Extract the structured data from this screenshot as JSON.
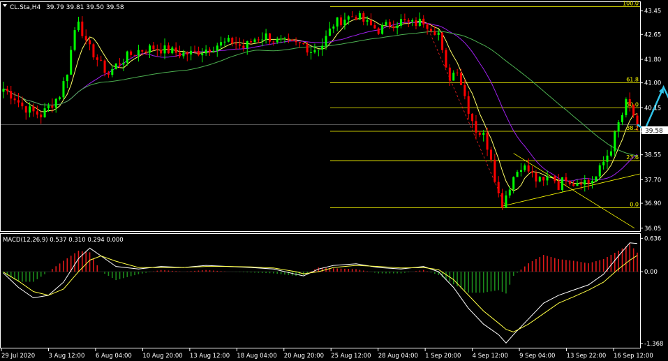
{
  "header": {
    "symbol": "CL.Sta,H4",
    "ohlc": "39.79 39.81 39.50 39.58",
    "macd_label": "MACD(12,26,9) 0.537 0.310 0.294 0.000"
  },
  "colors": {
    "background": "#000000",
    "bull": "#00ff00",
    "bear": "#ff0000",
    "fib": "#ffff00",
    "projection": "#2fc3e8",
    "ma_fast": "#ffff66",
    "ma_mid": "#a020f0",
    "ma_slow": "#4caf50",
    "macd_hist_pos": "#e01a1a",
    "macd_hist_neg": "#1c8a1c",
    "macd_line": "#ffffff",
    "signal_line": "#ffff44",
    "axis": "#ffffff",
    "grid": "#555555"
  },
  "chart_data": {
    "type": "candlestick",
    "price_axis": {
      "ticks": [
        "43.45",
        "42.65",
        "41.80",
        "41.00",
        "40.15",
        "39.35",
        "38.55",
        "37.70",
        "36.90",
        "36.05"
      ],
      "ylim": [
        35.95,
        43.75
      ],
      "current_price": "39.58"
    },
    "macd_axis": {
      "ticks": [
        "0.636",
        "0.00",
        "-1.368"
      ],
      "ylim": [
        -1.45,
        0.72
      ]
    },
    "x_labels": [
      "29 Jul 2020",
      "3 Aug 12:00",
      "6 Aug 04:00",
      "10 Aug 20:00",
      "13 Aug 12:00",
      "18 Aug 04:00",
      "20 Aug 20:00",
      "25 Aug 12:00",
      "28 Aug 04:00",
      "1 Sep 20:00",
      "4 Sep 12:00",
      "9 Sep 04:00",
      "13 Sep 22:00",
      "16 Sep 12:00"
    ],
    "fibonacci": {
      "levels": [
        {
          "label": "100.0",
          "price": 43.6
        },
        {
          "label": "61.8",
          "price": 41.0
        },
        {
          "label": "50.0",
          "price": 40.15
        },
        {
          "label": "38.2",
          "price": 39.35
        },
        {
          "label": "23.6",
          "price": 38.35
        },
        {
          "label": "0.0",
          "price": 36.75
        }
      ]
    },
    "path": [
      [
        0,
        40.8
      ],
      [
        3,
        40.5
      ],
      [
        5,
        40.2
      ],
      [
        8,
        40.0
      ],
      [
        10,
        39.9
      ],
      [
        13,
        40.3
      ],
      [
        15,
        40.6
      ],
      [
        17,
        41.4
      ],
      [
        19,
        42.8
      ],
      [
        20,
        43.2
      ],
      [
        22,
        42.3
      ],
      [
        24,
        42.0
      ],
      [
        26,
        41.6
      ],
      [
        28,
        41.3
      ],
      [
        30,
        41.6
      ],
      [
        33,
        41.9
      ],
      [
        36,
        42.1
      ],
      [
        40,
        42.2
      ],
      [
        44,
        42.1
      ],
      [
        47,
        42.0
      ],
      [
        50,
        42.0
      ],
      [
        53,
        42.1
      ],
      [
        57,
        42.3
      ],
      [
        61,
        42.4
      ],
      [
        64,
        42.2
      ],
      [
        67,
        42.5
      ],
      [
        70,
        42.6
      ],
      [
        73,
        42.4
      ],
      [
        77,
        42.3
      ],
      [
        80,
        42.3
      ],
      [
        82,
        42.1
      ],
      [
        85,
        42.3
      ],
      [
        88,
        43.0
      ],
      [
        91,
        43.2
      ],
      [
        94,
        43.3
      ],
      [
        97,
        43.0
      ],
      [
        100,
        42.8
      ],
      [
        103,
        43.0
      ],
      [
        106,
        43.1
      ],
      [
        109,
        43.0
      ],
      [
        112,
        43.1
      ],
      [
        114,
        42.9
      ],
      [
        116,
        42.7
      ],
      [
        117,
        42.0
      ],
      [
        118,
        41.4
      ],
      [
        119,
        41.2
      ],
      [
        121,
        41.5
      ],
      [
        122,
        41.0
      ],
      [
        124,
        40.1
      ],
      [
        126,
        39.4
      ],
      [
        128,
        39.2
      ],
      [
        130,
        38.5
      ],
      [
        131,
        37.8
      ],
      [
        132,
        37.2
      ],
      [
        133,
        36.9
      ],
      [
        134,
        37.2
      ],
      [
        136,
        37.8
      ],
      [
        138,
        38.2
      ],
      [
        140,
        38.0
      ],
      [
        142,
        37.7
      ],
      [
        144,
        37.6
      ],
      [
        146,
        37.9
      ],
      [
        148,
        37.5
      ],
      [
        150,
        37.8
      ],
      [
        152,
        37.6
      ],
      [
        154,
        37.7
      ],
      [
        156,
        37.6
      ],
      [
        158,
        37.8
      ],
      [
        160,
        38.3
      ],
      [
        162,
        38.8
      ],
      [
        163,
        39.2
      ],
      [
        164,
        39.6
      ],
      [
        165,
        39.9
      ],
      [
        166,
        40.3
      ],
      [
        167,
        40.2
      ],
      [
        168,
        39.9
      ],
      [
        169,
        39.58
      ]
    ],
    "projection": [
      [
        169,
        39.58
      ],
      [
        171,
        39.4
      ],
      [
        176,
        40.85
      ],
      [
        185,
        38.45
      ]
    ],
    "macd": [
      [
        0,
        -0.03
      ],
      [
        4,
        -0.3
      ],
      [
        8,
        -0.5
      ],
      [
        12,
        -0.45
      ],
      [
        16,
        -0.2
      ],
      [
        20,
        0.25
      ],
      [
        23,
        0.45
      ],
      [
        26,
        0.3
      ],
      [
        30,
        0.1
      ],
      [
        36,
        0.05
      ],
      [
        42,
        0.1
      ],
      [
        48,
        0.08
      ],
      [
        54,
        0.12
      ],
      [
        60,
        0.1
      ],
      [
        66,
        0.08
      ],
      [
        72,
        0.05
      ],
      [
        78,
        -0.05
      ],
      [
        80,
        -0.08
      ],
      [
        84,
        0.05
      ],
      [
        88,
        0.12
      ],
      [
        94,
        0.15
      ],
      [
        100,
        0.08
      ],
      [
        106,
        0.05
      ],
      [
        112,
        0.1
      ],
      [
        116,
        0.0
      ],
      [
        120,
        -0.3
      ],
      [
        124,
        -0.7
      ],
      [
        128,
        -1.0
      ],
      [
        132,
        -1.2
      ],
      [
        134,
        -1.36
      ],
      [
        136,
        -1.2
      ],
      [
        140,
        -0.9
      ],
      [
        144,
        -0.6
      ],
      [
        148,
        -0.45
      ],
      [
        152,
        -0.35
      ],
      [
        156,
        -0.25
      ],
      [
        160,
        -0.05
      ],
      [
        164,
        0.3
      ],
      [
        167,
        0.55
      ],
      [
        169,
        0.537
      ]
    ],
    "signal": [
      [
        0,
        -0.01
      ],
      [
        4,
        -0.18
      ],
      [
        8,
        -0.38
      ],
      [
        12,
        -0.45
      ],
      [
        16,
        -0.33
      ],
      [
        20,
        0.0
      ],
      [
        23,
        0.22
      ],
      [
        26,
        0.3
      ],
      [
        30,
        0.2
      ],
      [
        36,
        0.08
      ],
      [
        42,
        0.08
      ],
      [
        48,
        0.08
      ],
      [
        54,
        0.1
      ],
      [
        60,
        0.1
      ],
      [
        66,
        0.09
      ],
      [
        72,
        0.07
      ],
      [
        78,
        0.0
      ],
      [
        80,
        -0.04
      ],
      [
        84,
        0.0
      ],
      [
        88,
        0.08
      ],
      [
        94,
        0.12
      ],
      [
        100,
        0.1
      ],
      [
        106,
        0.07
      ],
      [
        112,
        0.08
      ],
      [
        116,
        0.04
      ],
      [
        120,
        -0.15
      ],
      [
        124,
        -0.45
      ],
      [
        128,
        -0.75
      ],
      [
        132,
        -0.98
      ],
      [
        134,
        -1.1
      ],
      [
        136,
        -1.15
      ],
      [
        140,
        -1.0
      ],
      [
        144,
        -0.8
      ],
      [
        148,
        -0.6
      ],
      [
        152,
        -0.48
      ],
      [
        156,
        -0.35
      ],
      [
        160,
        -0.2
      ],
      [
        164,
        0.05
      ],
      [
        167,
        0.22
      ],
      [
        169,
        0.31
      ]
    ]
  }
}
